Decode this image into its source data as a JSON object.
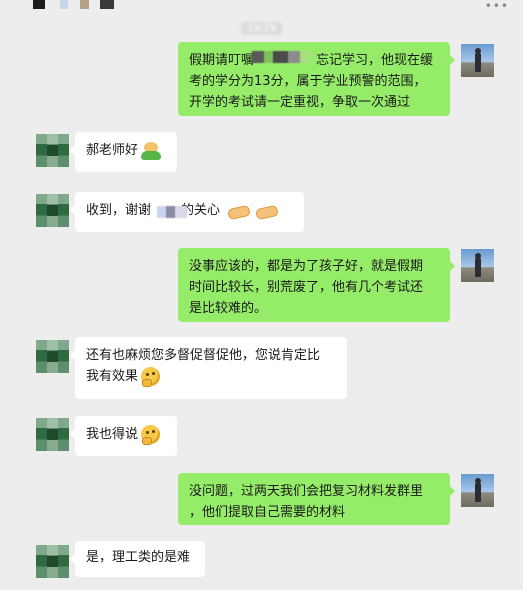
{
  "header": {
    "timestamp": "19:29",
    "more_icon": "more-horizontal-icon",
    "colors": {
      "background": "#ededed",
      "outgoing_bubble": "#95ec69",
      "incoming_bubble": "#ffffff"
    }
  },
  "messages": [
    {
      "side": "right",
      "avatar": "user-avatar-icon",
      "lines": [
        "假期请叮嘱",
        "忘记学习，他现在缓",
        "考的学分为13分，属于学业预警的范围，",
        "开学的考试请一定重视，争取一次通过"
      ]
    },
    {
      "side": "left",
      "avatar": "contact-avatar-icon",
      "lines": [
        "郝老师好"
      ],
      "emoji": "smiling-frog-emoji"
    },
    {
      "side": "left",
      "avatar": "contact-avatar-icon",
      "lines": [
        "收到，谢谢",
        "的关心"
      ],
      "emoji": "handshake-emoji"
    },
    {
      "side": "right",
      "avatar": "user-avatar-icon",
      "lines": [
        "没事应该的，都是为了孩子好，就是假期",
        "时间比较长，别荒废了，他有几个考试还",
        "是比较难的。"
      ]
    },
    {
      "side": "left",
      "avatar": "contact-avatar-icon",
      "lines": [
        "还有也麻烦您多督促督促他，您说肯定比",
        "我有效果"
      ],
      "emoji": "thinking-emoji"
    },
    {
      "side": "left",
      "avatar": "contact-avatar-icon",
      "lines": [
        "我也得说"
      ],
      "emoji": "thinking-emoji"
    },
    {
      "side": "right",
      "avatar": "user-avatar-icon",
      "lines": [
        "没问题，过两天我们会把复习材料发群里",
        "，他们提取自己需要的材料"
      ]
    },
    {
      "side": "left",
      "avatar": "contact-avatar-icon",
      "lines": [
        "是，理工类的是难"
      ]
    }
  ]
}
